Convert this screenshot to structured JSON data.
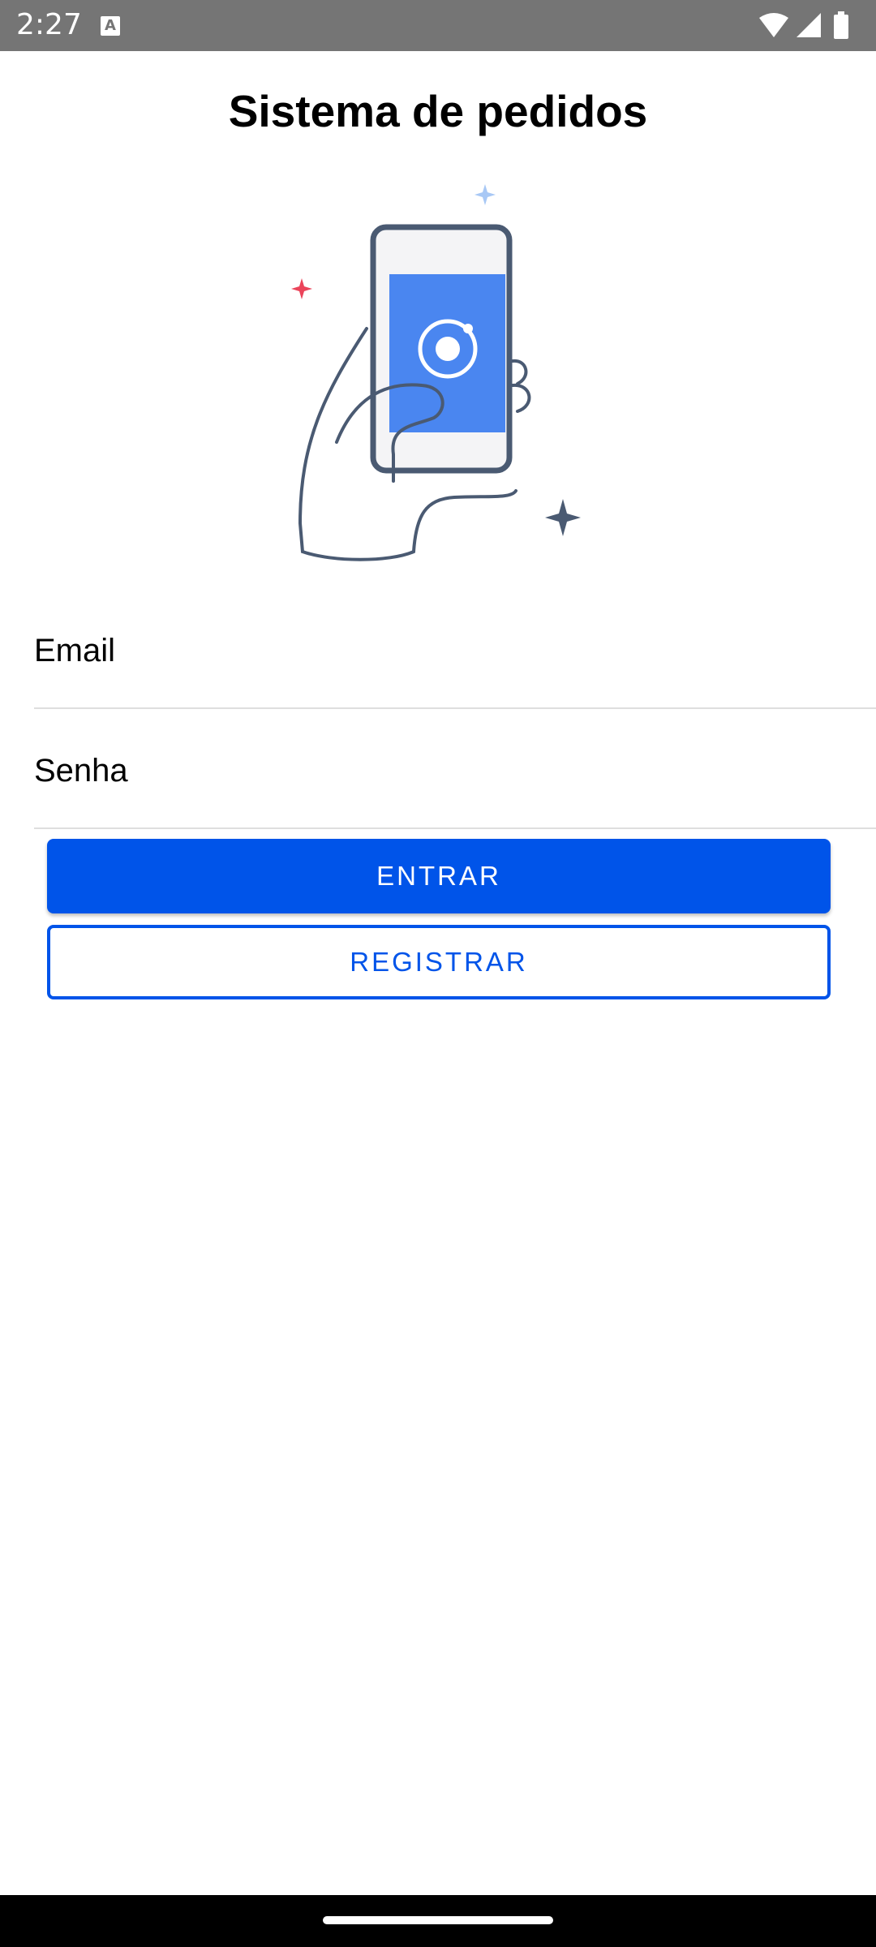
{
  "status_bar": {
    "time": "2:27",
    "notification_icon": "A",
    "icons": [
      "wifi-icon",
      "signal-icon",
      "battery-icon"
    ]
  },
  "header": {
    "title": "Sistema de pedidos"
  },
  "illustration": {
    "name": "hand-holding-phone-illustration",
    "colors": {
      "phone_screen": "#4a86f0",
      "outline": "#4a5a72",
      "sparkle_red": "#eb445a",
      "sparkle_blue": "#a8c8f5",
      "sparkle_dark": "#4a5a72"
    }
  },
  "form": {
    "email_label": "Email",
    "password_label": "Senha"
  },
  "buttons": {
    "login_label": "ENTRAR",
    "register_label": "REGISTRAR"
  },
  "colors": {
    "primary": "#0054e9",
    "status_bar": "#757575",
    "divider": "#dedede"
  }
}
